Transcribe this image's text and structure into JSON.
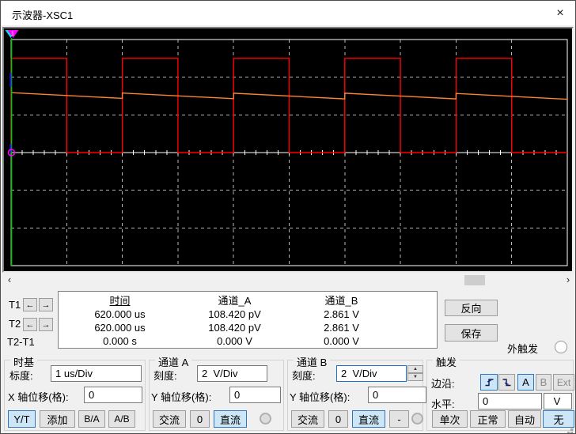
{
  "window": {
    "title": "示波器-XSC1"
  },
  "icons": {
    "close": "×",
    "cursor_left": "←",
    "cursor_right": "→",
    "scroll_left": "‹",
    "scroll_right": "›",
    "spin_up": "▲",
    "spin_down": "▼",
    "edge_rise": "rising-edge",
    "edge_fall": "falling-edge"
  },
  "cursors_panel": {
    "t1": "T1",
    "t2": "T2",
    "dt": "T2-T1"
  },
  "measurements": {
    "headers": {
      "time": "时间",
      "channel_a": "通道_A",
      "channel_b": "通道_B"
    },
    "rows": [
      {
        "time": "620.000 us",
        "channel_a": "108.420 pV",
        "channel_b": "2.861 V"
      },
      {
        "time": "620.000 us",
        "channel_a": "108.420 pV",
        "channel_b": "2.861 V"
      },
      {
        "time": "0.000 s",
        "channel_a": "0.000 V",
        "channel_b": "0.000 V"
      }
    ]
  },
  "actions": {
    "reverse": "反向",
    "save": "保存",
    "ext_trigger": "外触发"
  },
  "timebase": {
    "title": "时基",
    "scale_label": "标度:",
    "scale_value": "1 us/Div",
    "xpos_label": "X 轴位移(格):",
    "xpos_value": "0",
    "buttons": {
      "yt": "Y/T",
      "add": "添加",
      "ba": "B/A",
      "ab": "A/B"
    }
  },
  "channel_a": {
    "title": "通道 A",
    "scale_label": "刻度:",
    "scale_value": "2  V/Div",
    "ypos_label": "Y 轴位移(格):",
    "ypos_value": "0",
    "buttons": {
      "ac": "交流",
      "zero": "0",
      "dc": "直流"
    }
  },
  "channel_b": {
    "title": "通道 B",
    "scale_label": "刻度:",
    "scale_value": "2  V/Div",
    "ypos_label": "Y 轴位移(格):",
    "ypos_value": "0",
    "buttons": {
      "ac": "交流",
      "zero": "0",
      "dc": "直流",
      "minus": "-"
    }
  },
  "trigger": {
    "title": "触发",
    "edge_label": "边沿:",
    "sources": {
      "a": "A",
      "b": "B",
      "ext": "Ext"
    },
    "level_label": "水平:",
    "level_value": "0",
    "level_unit": "V",
    "buttons": {
      "single": "单次",
      "normal": "正常",
      "auto": "自动",
      "none": "无"
    }
  },
  "scope": {
    "colors": {
      "bg": "#000000",
      "grid": "#ffffff",
      "grid_dashed": "#b4b4b4",
      "cursor1_blue": "#2222ee",
      "cursor2_green": "#00cc00",
      "marker_magenta": "#ff00ff",
      "triangle_cyan": "#00e0e0",
      "triangle_magenta": "#ff00ff",
      "trace_a": "#ff0000",
      "trace_b": "#ff8432"
    },
    "cursor_x_div": 0,
    "cursor_label": "1"
  },
  "chart_data": {
    "type": "line",
    "title": "oscilloscope-trace",
    "divs_x": 10,
    "divs_y": 6,
    "time_per_div": "1 us",
    "v_per_div": 2,
    "series": [
      {
        "name": "channel_A",
        "color": "#ff0000",
        "points": [
          [
            0,
            0
          ],
          [
            0,
            5
          ],
          [
            1,
            5
          ],
          [
            1,
            0
          ],
          [
            2,
            0
          ],
          [
            2,
            5
          ],
          [
            3,
            5
          ],
          [
            3,
            0
          ],
          [
            4,
            0
          ],
          [
            4,
            5
          ],
          [
            5,
            5
          ],
          [
            5,
            0
          ],
          [
            6,
            0
          ],
          [
            6,
            5
          ],
          [
            7,
            5
          ],
          [
            7,
            0
          ],
          [
            8,
            0
          ],
          [
            8,
            5
          ],
          [
            9,
            5
          ],
          [
            9,
            0
          ],
          [
            10,
            0
          ]
        ]
      },
      {
        "name": "channel_B",
        "color": "#ff8432",
        "points": [
          [
            0,
            3.18
          ],
          [
            2,
            2.88
          ],
          [
            2,
            3.16
          ],
          [
            4,
            2.86
          ],
          [
            4,
            3.15
          ],
          [
            6,
            2.85
          ],
          [
            6,
            3.15
          ],
          [
            8,
            2.85
          ],
          [
            8,
            3.14
          ],
          [
            10,
            2.83
          ]
        ]
      }
    ]
  }
}
